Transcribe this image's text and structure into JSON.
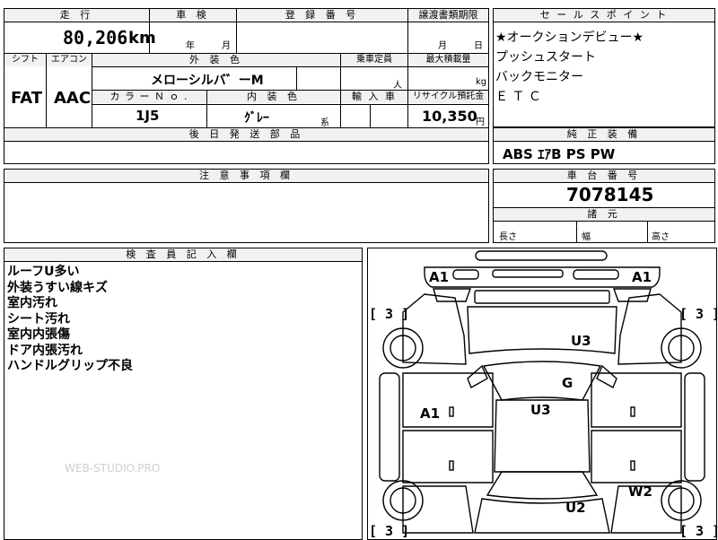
{
  "headers": {
    "mileage": "走 行",
    "inspection": "車 検",
    "registration_no": "登 録 番 号",
    "transfer_deadline": "譲渡書類期限",
    "sales_point": "セ ー ル ス ポ イ ン ト",
    "shift": "シフト",
    "aircon": "エアコン",
    "exterior_color": "外 装 色",
    "capacity": "乗車定員",
    "max_load": "最大積載量",
    "color_no": "カ ラ ー Ｎ ｏ .",
    "interior_color": "内 装 色",
    "import": "輸 入 車",
    "recycle": "リサイクル預託金",
    "later_parts": "後 日 発 送 部 品",
    "std_equipment": "純 正 装 備",
    "notes": "注 意 事 項 欄",
    "chassis_no": "車 台 番 号",
    "dimensions": "諸 元",
    "inspector": "検 査 員 記 入 欄"
  },
  "values": {
    "mileage": "80,206",
    "mileage_unit": "km",
    "inspection_year": "年",
    "inspection_month": "月",
    "transfer_month": "月",
    "transfer_day": "日",
    "shift": "FAT",
    "aircon": "AAC",
    "exterior_color": "メローシルバ゛ーM",
    "capacity_unit": "人",
    "max_load_unit": "kg",
    "color_no": "1J5",
    "interior_color": "ｸﾞﾚｰ",
    "interior_suffix": "系",
    "recycle": "10,350",
    "recycle_unit": "円",
    "std_equipment": "ABS ｴｱB PS PW",
    "chassis_no": "7078145",
    "length_label": "長さ",
    "width_label": "幅",
    "height_label": "高さ"
  },
  "sales_points": [
    "★オークションデビュー★",
    "プッシュスタート",
    "バックモニター",
    "Ｅ Ｔ Ｃ"
  ],
  "inspector_notes": [
    "ルーフU多い",
    "外装うすい線キズ",
    "室内汚れ",
    "シート汚れ",
    "室内内張傷",
    "ドア内張汚れ",
    "ハンドルグリップ不良"
  ],
  "watermark": "WEB-STUDIO.PRO",
  "diagram": {
    "tire_label": "[ 3 ]",
    "marks": {
      "front_left": "A1",
      "front_right": "A1",
      "hood": "U3",
      "windshield": "G",
      "roof": "U3",
      "door_left": "A1",
      "trunk": "U2",
      "rear_right": "W2"
    }
  }
}
